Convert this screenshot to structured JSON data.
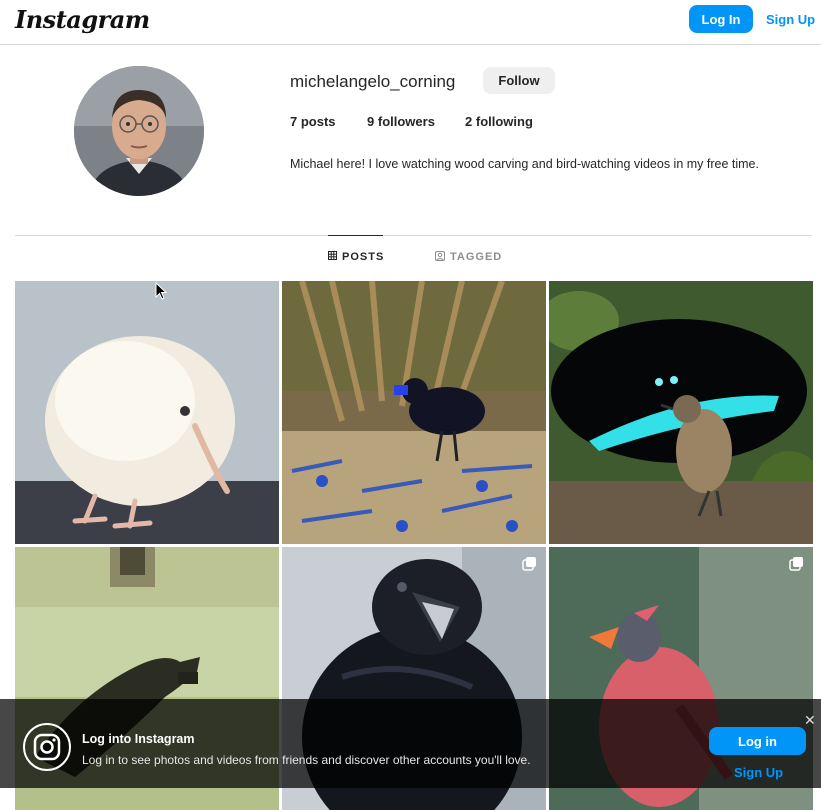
{
  "nav": {
    "logo_text": "Instagram",
    "login_label": "Log In",
    "signup_label": "Sign Up"
  },
  "profile": {
    "username": "michelangelo_corning",
    "follow_label": "Follow",
    "posts_count": "7",
    "posts_label": "posts",
    "followers_count": "9",
    "followers_label": "followers",
    "following_count": "2",
    "following_label": "following",
    "bio": "Michael here! I love watching wood carving and bird-watching videos in my free time."
  },
  "tabs": [
    {
      "label": "POSTS",
      "icon": "grid-icon",
      "active": true
    },
    {
      "label": "TAGGED",
      "icon": "tag-icon",
      "active": false
    }
  ],
  "posts": [
    {
      "subject": "white-kiwi-bird",
      "multi": false
    },
    {
      "subject": "bowerbird-blue-objects",
      "multi": false
    },
    {
      "subject": "bird-of-paradise-display",
      "multi": false
    },
    {
      "subject": "crow-silhouette",
      "multi": false
    },
    {
      "subject": "raven",
      "multi": true
    },
    {
      "subject": "red-bird",
      "multi": true
    }
  ],
  "banner": {
    "title": "Log into Instagram",
    "text": "Log in to see photos and videos from friends and discover other accounts you'll love.",
    "login_label": "Log in",
    "signup_label": "Sign Up",
    "close_icon": "close-icon"
  },
  "colors": {
    "accent": "#0095f6",
    "text": "#262626",
    "muted": "#8e8e8e",
    "border": "#dbdbdb"
  }
}
